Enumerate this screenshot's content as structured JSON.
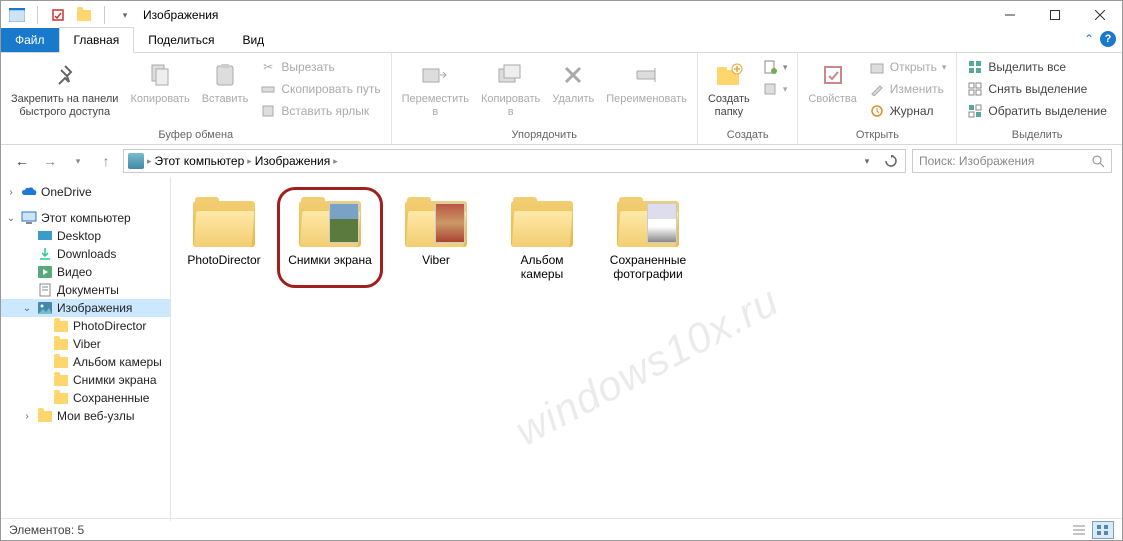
{
  "window": {
    "title": "Изображения"
  },
  "tabs": {
    "file": "Файл",
    "home": "Главная",
    "share": "Поделиться",
    "view": "Вид"
  },
  "ribbon": {
    "clipboard": {
      "label": "Буфер обмена",
      "pin": "Закрепить на панели\nбыстрого доступа",
      "copy": "Копировать",
      "paste": "Вставить",
      "cut": "Вырезать",
      "copy_path": "Скопировать путь",
      "paste_shortcut": "Вставить ярлык"
    },
    "organize": {
      "label": "Упорядочить",
      "move": "Переместить\nв",
      "copy_to": "Копировать\nв",
      "delete": "Удалить",
      "rename": "Переименовать"
    },
    "new": {
      "label": "Создать",
      "new_folder": "Создать\nпапку"
    },
    "open": {
      "label": "Открыть",
      "properties": "Свойства",
      "open": "Открыть",
      "edit": "Изменить",
      "history": "Журнал"
    },
    "select": {
      "label": "Выделить",
      "all": "Выделить все",
      "none": "Снять выделение",
      "invert": "Обратить выделение"
    }
  },
  "breadcrumb": {
    "seg0": "Этот компьютер",
    "seg1": "Изображения"
  },
  "search": {
    "placeholder": "Поиск: Изображения"
  },
  "sidebar": {
    "items": [
      {
        "label": "OneDrive",
        "icon": "cloud"
      },
      {
        "label": "Этот компьютер",
        "icon": "pc"
      },
      {
        "label": "Desktop",
        "icon": "desktop"
      },
      {
        "label": "Downloads",
        "icon": "download"
      },
      {
        "label": "Видео",
        "icon": "video"
      },
      {
        "label": "Документы",
        "icon": "doc"
      },
      {
        "label": "Изображения",
        "icon": "pic"
      },
      {
        "label": "PhotoDirector",
        "icon": "folder"
      },
      {
        "label": "Viber",
        "icon": "folder"
      },
      {
        "label": "Альбом камеры",
        "icon": "folder"
      },
      {
        "label": "Снимки экрана",
        "icon": "folder"
      },
      {
        "label": "Сохраненные",
        "icon": "folder"
      },
      {
        "label": "Мои веб-узлы",
        "icon": "web"
      }
    ]
  },
  "items": [
    {
      "label": "PhotoDirector",
      "thumb": null
    },
    {
      "label": "Снимки экрана",
      "thumb": "photo1",
      "highlight": true
    },
    {
      "label": "Viber",
      "thumb": "photo2"
    },
    {
      "label": "Альбом камеры",
      "thumb": null
    },
    {
      "label": "Сохраненные фотографии",
      "thumb": "photo3"
    }
  ],
  "status": {
    "text": "Элементов: 5"
  },
  "watermark": "windows10x.ru"
}
